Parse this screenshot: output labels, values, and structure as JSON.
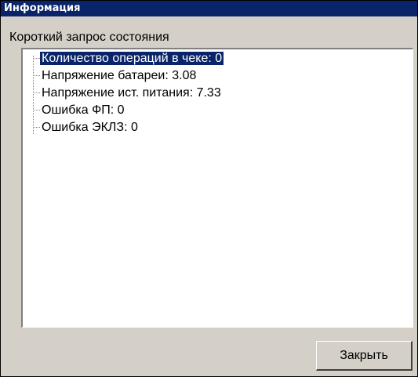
{
  "window": {
    "title": "Информация"
  },
  "header": {
    "label": "Короткий запрос состояния"
  },
  "tree": {
    "items": [
      {
        "label": "Количество операций в чеке: 0",
        "selected": true
      },
      {
        "label": "Напряжение батареи: 3.08",
        "selected": false
      },
      {
        "label": "Напряжение ист. питания: 7.33",
        "selected": false
      },
      {
        "label": "Ошибка ФП: 0",
        "selected": false
      },
      {
        "label": "Ошибка ЭКЛЗ: 0",
        "selected": false
      }
    ]
  },
  "buttons": {
    "close_label": "Закрыть"
  },
  "colors": {
    "titlebar": "#0a246a",
    "window_bg": "#d4d0c8",
    "selection": "#0a246a"
  }
}
